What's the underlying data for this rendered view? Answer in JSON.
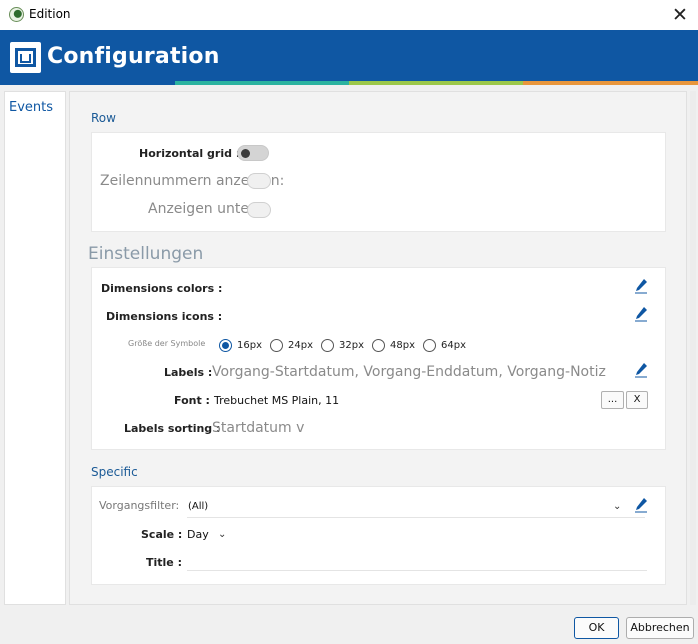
{
  "window": {
    "title": "Edition",
    "close_glyph": "✕"
  },
  "header": {
    "title": "Configuration",
    "accent_colors": [
      "#2bb3a0",
      "#9cc84a",
      "#e8963c"
    ],
    "brand_color": "#0f57a3"
  },
  "sidebar": {
    "items": [
      {
        "label": "Events"
      }
    ]
  },
  "row_section": {
    "title": "Row",
    "horizontal_grid": {
      "label": "Horizontal grid :",
      "on": false
    },
    "zeilennummern": {
      "label": "Zeilennummern anzeigen:"
    },
    "anzeigen_unter": {
      "label": "Anzeigen unter"
    }
  },
  "einstellungen": {
    "title": "Einstellungen",
    "dimensions_colors": {
      "label": "Dimensions colors :",
      "icon": "pencil-icon"
    },
    "dimensions_icons": {
      "label": "Dimensions icons :",
      "icon": "pencil-icon"
    },
    "icon_size": {
      "label": "Größe der Symbole",
      "options": [
        "16px",
        "24px",
        "32px",
        "48px",
        "64px"
      ],
      "selected": "16px"
    },
    "labels": {
      "label": "Labels :",
      "value": "Vorgang-Startdatum, Vorgang-Enddatum, Vorgang-Notiz"
    },
    "font": {
      "label": "Font :",
      "value": "Trebuchet MS Plain, 11",
      "browse": "...",
      "clear": "X"
    },
    "labels_sorting": {
      "label": "Labels sorting :",
      "value": "Startdatum v"
    }
  },
  "specific": {
    "title": "Specific",
    "vorgangsfilter": {
      "label": "Vorgangsfilter:",
      "value": "(All)"
    },
    "scale": {
      "label": "Scale :",
      "value": "Day"
    },
    "title_field": {
      "label": "Title :",
      "value": ""
    }
  },
  "footer": {
    "ok": "OK",
    "cancel": "Abbrechen"
  }
}
